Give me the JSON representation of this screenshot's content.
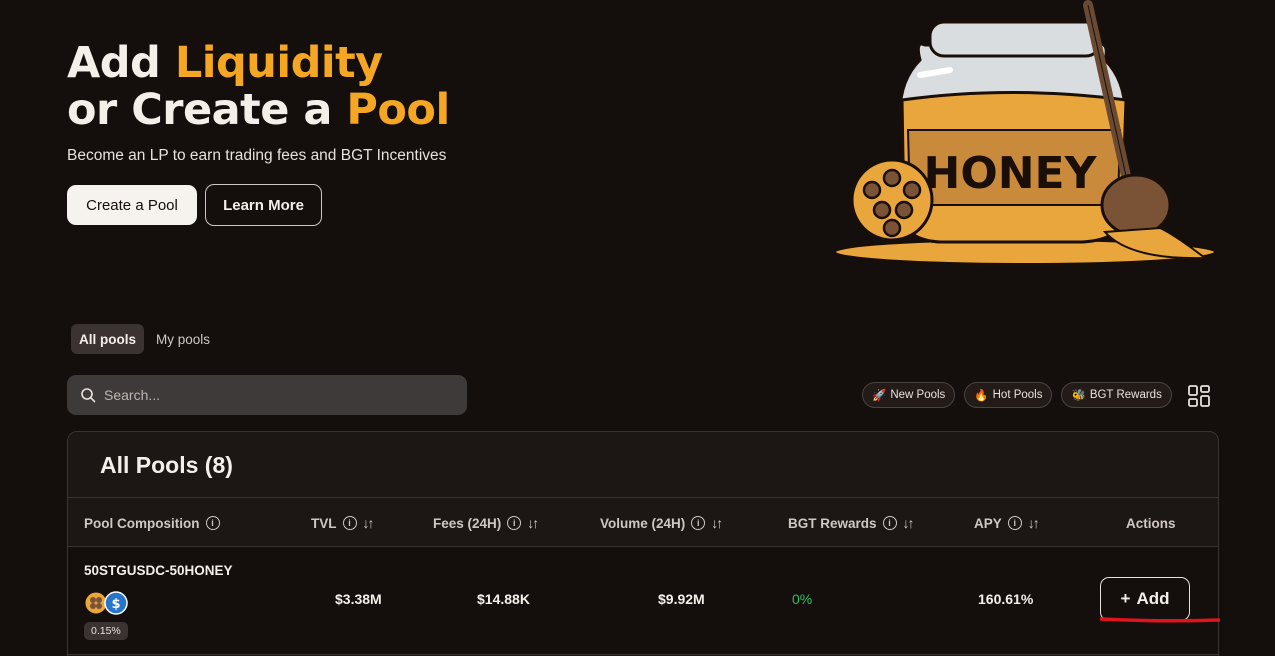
{
  "hero": {
    "title_part1": "Add ",
    "title_highlight1": "Liquidity",
    "title_part2": "or Create a ",
    "title_highlight2": "Pool",
    "subtitle": "Become an LP to earn trading fees and BGT Incentives",
    "create_button": "Create a Pool",
    "learn_button": "Learn More",
    "jar_label": "HONEY"
  },
  "tabs": [
    {
      "label": "All pools",
      "active": true
    },
    {
      "label": "My pools",
      "active": false
    }
  ],
  "search": {
    "placeholder": "Search..."
  },
  "filters": [
    {
      "icon": "rocket-icon",
      "glyph": "🚀",
      "label": "New Pools"
    },
    {
      "icon": "fire-icon",
      "glyph": "🔥",
      "label": "Hot Pools"
    },
    {
      "icon": "bee-icon",
      "glyph": "🐝",
      "label": "BGT Rewards"
    }
  ],
  "table": {
    "title": "All Pools (8)",
    "columns": [
      {
        "label": "Pool Composition",
        "info": true,
        "sort": false
      },
      {
        "label": "TVL",
        "info": true,
        "sort": true
      },
      {
        "label": "Fees (24H)",
        "info": true,
        "sort": true
      },
      {
        "label": "Volume (24H)",
        "info": true,
        "sort": true
      },
      {
        "label": "BGT Rewards",
        "info": true,
        "sort": true
      },
      {
        "label": "APY",
        "info": true,
        "sort": true
      },
      {
        "label": "Actions",
        "info": false,
        "sort": false
      }
    ],
    "rows": [
      {
        "name": "50STGUSDC-50HONEY",
        "fee": "0.15%",
        "tvl": "$3.38M",
        "fees_24h": "$14.88K",
        "volume_24h": "$9.92M",
        "bgt_rewards": "0%",
        "apy": "160.61%",
        "action": "Add"
      }
    ]
  },
  "colors": {
    "background": "#140e0c",
    "accent": "#f5a623",
    "positive": "#22c55e",
    "annotation": "#e0141e"
  }
}
